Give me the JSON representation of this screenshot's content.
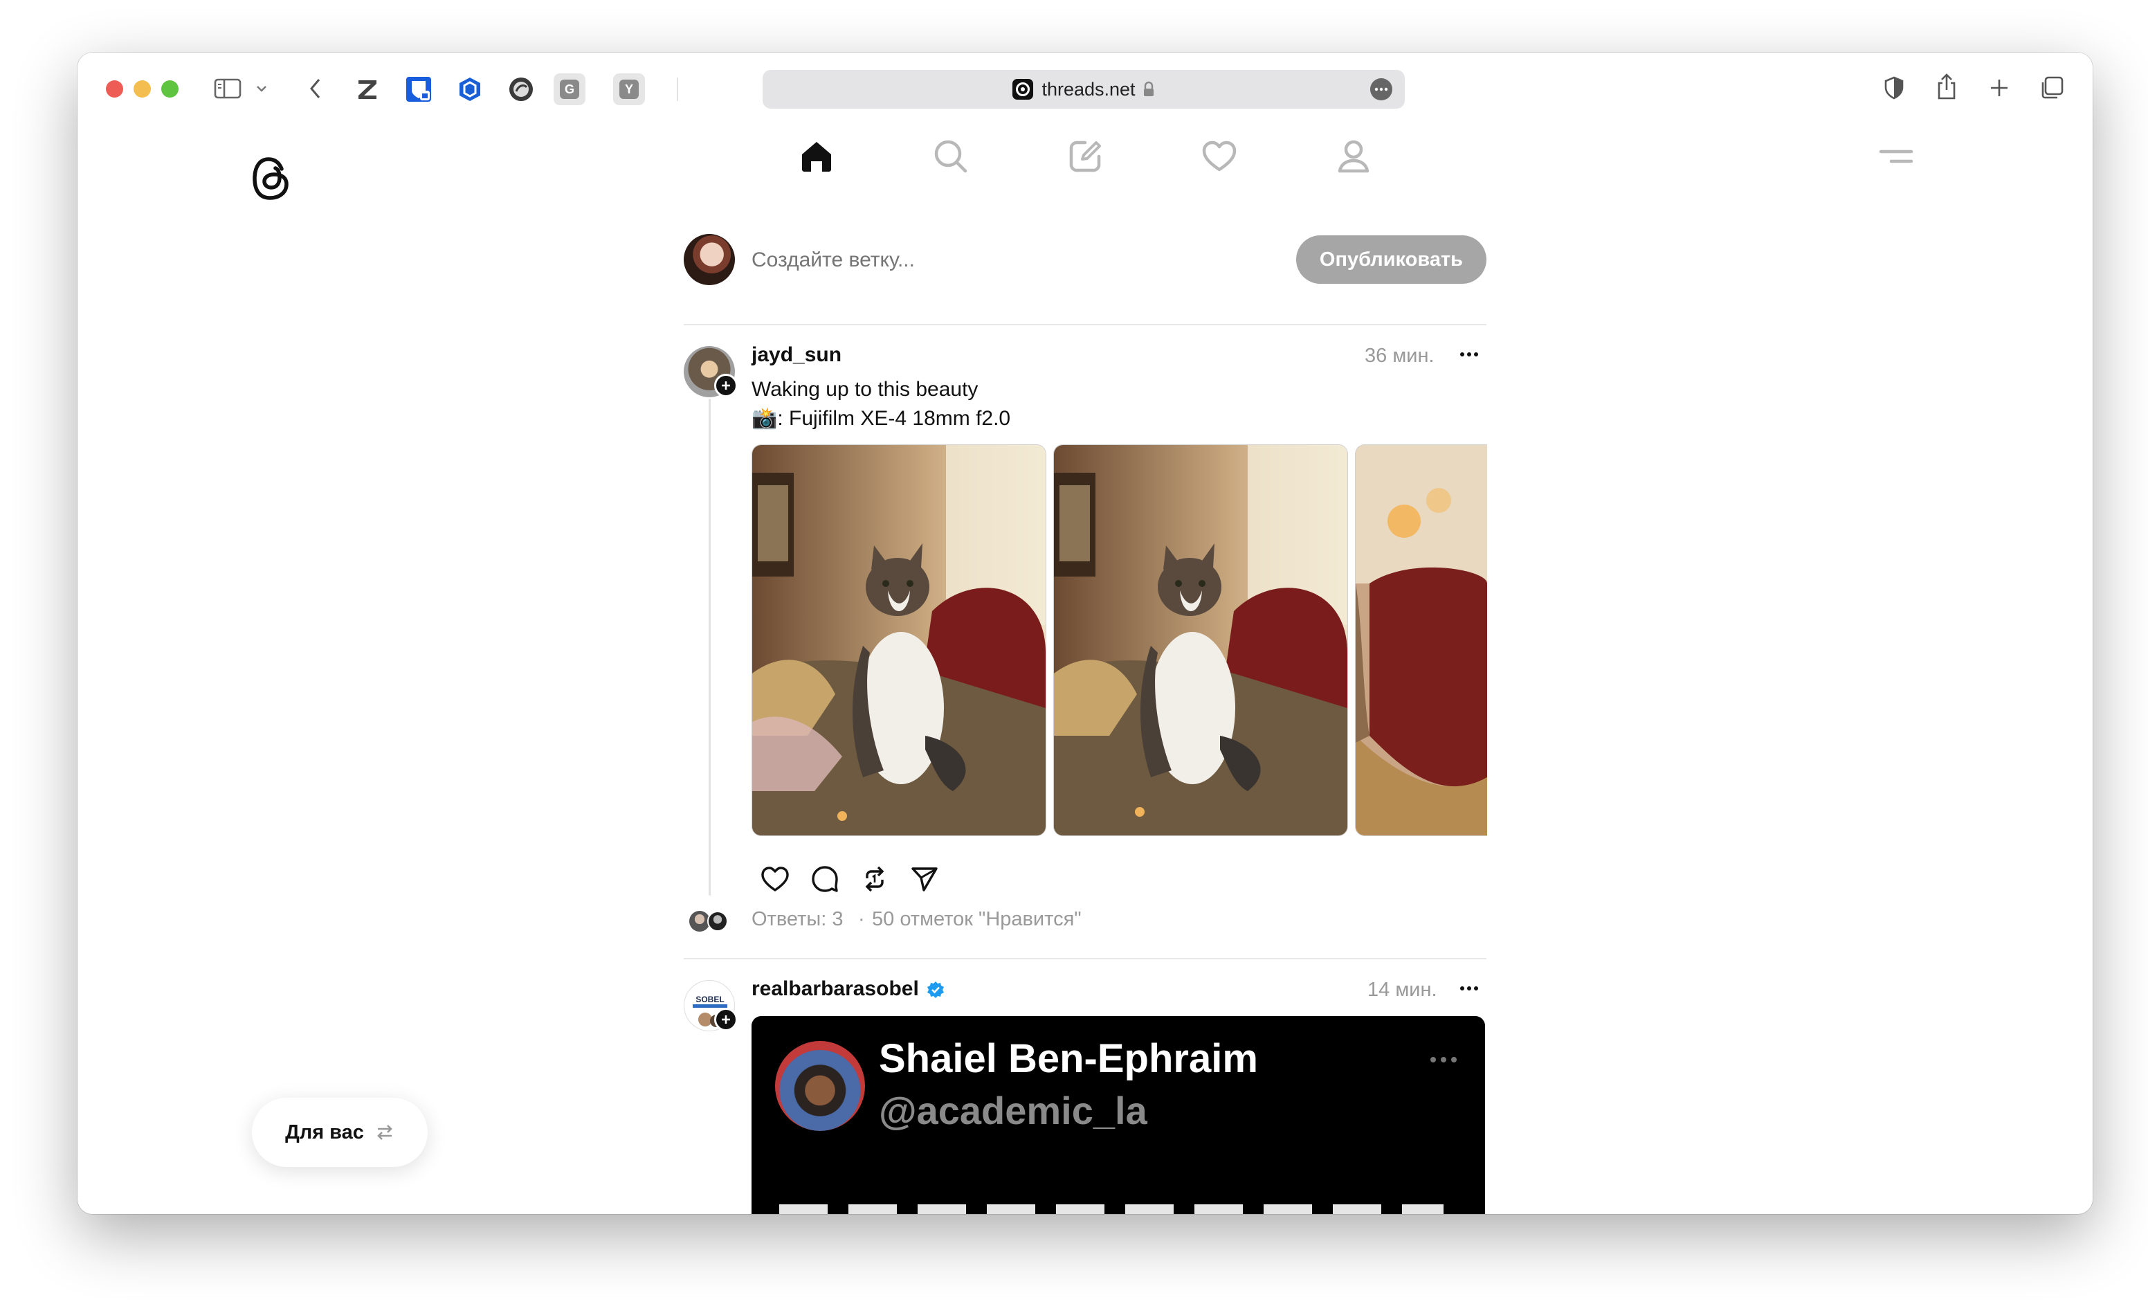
{
  "browser": {
    "url": "threads.net",
    "colors": {
      "close": "#ee5d55",
      "minimize": "#f4bd4f",
      "maximize": "#5fc43f"
    },
    "favicons": [
      {
        "name": "zotero-icon",
        "letter": "Z"
      },
      {
        "name": "bitwarden-icon",
        "letter": ""
      },
      {
        "name": "hex-extension-icon",
        "letter": ""
      },
      {
        "name": "globe-extension-icon",
        "letter": ""
      },
      {
        "name": "grammar-extension-icon",
        "letter": "G"
      },
      {
        "name": "ycombinator-extension-icon",
        "letter": "Y"
      }
    ]
  },
  "composer": {
    "placeholder": "Создайте ветку...",
    "publish_label": "Опубликовать"
  },
  "posts": [
    {
      "username": "jayd_sun",
      "time": "36 мин.",
      "lines": [
        "Waking up to this beauty",
        "📸: Fujifilm XE-4 18mm f2.0"
      ],
      "replies": "Ответы: 3",
      "separator": "·",
      "likes": "50 отметок \"Нравится\""
    },
    {
      "username": "realbarbarasobel",
      "time": "14 мин.",
      "verified": true,
      "embed": {
        "name": "Shaiel Ben-Ephraim",
        "handle": "@academic_la"
      }
    }
  ],
  "feed_switch": {
    "label": "Для вас"
  }
}
